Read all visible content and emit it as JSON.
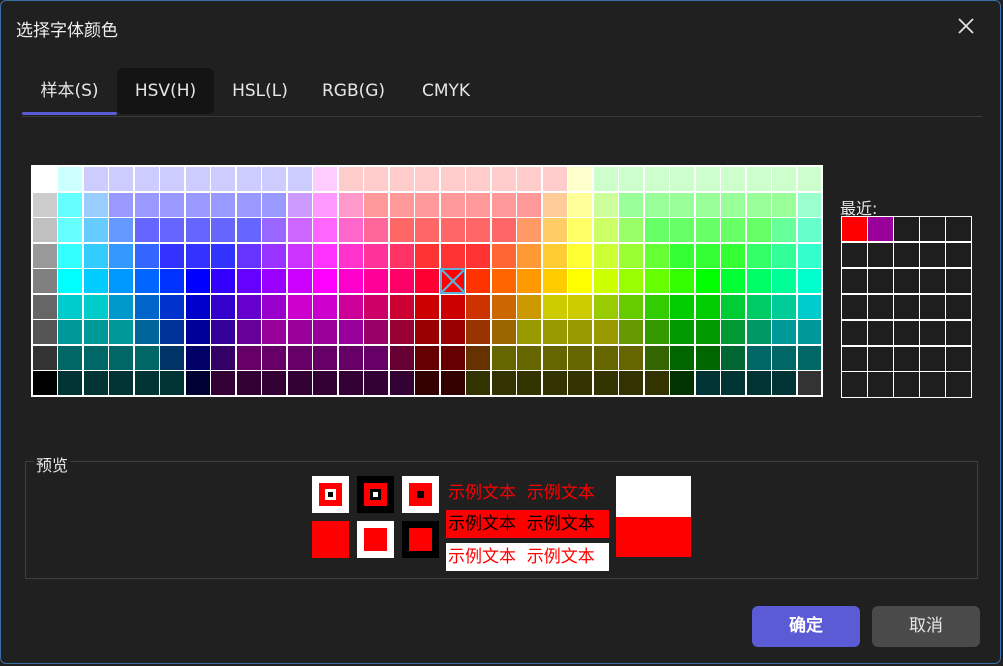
{
  "dialog": {
    "title": "选择字体颜色"
  },
  "tabs": [
    {
      "label": "样本(S)",
      "active": true
    },
    {
      "label": "HSV(H)",
      "hovered": true
    },
    {
      "label": "HSL(L)"
    },
    {
      "label": "RGB(G)"
    },
    {
      "label": "CMYK"
    }
  ],
  "palette": {
    "selected": {
      "row": 4,
      "col": 16
    },
    "rows": [
      [
        "#ffffff",
        "#ccffff",
        "#ccccff",
        "#ccccff",
        "#ccccff",
        "#ccccff",
        "#ccccff",
        "#ccccff",
        "#ccccff",
        "#ccccff",
        "#ccccff",
        "#ffccff",
        "#ffcccc",
        "#ffcccc",
        "#ffcccc",
        "#ffcccc",
        "#ffcccc",
        "#ffcccc",
        "#ffcccc",
        "#ffcccc",
        "#ffcccc",
        "#ffffcc",
        "#ccffcc",
        "#ccffcc",
        "#ccffcc",
        "#ccffcc",
        "#ccffcc",
        "#ccffcc",
        "#ccffcc",
        "#ccffcc",
        "#ccffcc"
      ],
      [
        "#cccccc",
        "#66ffff",
        "#99ccff",
        "#9999ff",
        "#9999ff",
        "#9999ff",
        "#9999ff",
        "#9999ff",
        "#9999ff",
        "#9999ff",
        "#cc99ff",
        "#ff99ff",
        "#ff99cc",
        "#ff9999",
        "#ff9999",
        "#ff9999",
        "#ff9999",
        "#ff9999",
        "#ff9999",
        "#ff9999",
        "#ffcc99",
        "#ffff99",
        "#ccff99",
        "#99ff99",
        "#99ff99",
        "#99ff99",
        "#99ff99",
        "#99ff99",
        "#99ff99",
        "#99ff99",
        "#99ffcc"
      ],
      [
        "#c0c0c0",
        "#66ffff",
        "#66ccff",
        "#6699ff",
        "#6666ff",
        "#6666ff",
        "#6666ff",
        "#6666ff",
        "#6666ff",
        "#9966ff",
        "#cc66ff",
        "#ff66ff",
        "#ff66cc",
        "#ff6699",
        "#ff6666",
        "#ff6666",
        "#ff6666",
        "#ff6666",
        "#ff6666",
        "#ff9966",
        "#ffcc66",
        "#ffff66",
        "#ccff66",
        "#99ff66",
        "#66ff66",
        "#66ff66",
        "#66ff66",
        "#66ff66",
        "#66ff66",
        "#66ff99",
        "#66ffcc"
      ],
      [
        "#999999",
        "#33ffff",
        "#33ccff",
        "#3399ff",
        "#3366ff",
        "#3333ff",
        "#3333ff",
        "#3333ff",
        "#6633ff",
        "#9933ff",
        "#cc33ff",
        "#ff33ff",
        "#ff33cc",
        "#ff3399",
        "#ff3366",
        "#ff3333",
        "#ff3333",
        "#ff3333",
        "#ff6633",
        "#ff9933",
        "#ffcc33",
        "#ffff33",
        "#ccff33",
        "#99ff33",
        "#66ff33",
        "#33ff33",
        "#33ff33",
        "#33ff33",
        "#33ff66",
        "#33ff99",
        "#33ffcc"
      ],
      [
        "#808080",
        "#00ffff",
        "#00ccff",
        "#0099ff",
        "#0066ff",
        "#0033ff",
        "#0000ff",
        "#3300ff",
        "#6600ff",
        "#9900ff",
        "#cc00ff",
        "#ff00ff",
        "#ff00cc",
        "#ff0099",
        "#ff0066",
        "#ff0033",
        "#ff0000",
        "#ff3300",
        "#ff6600",
        "#ff9900",
        "#ffcc00",
        "#ffff00",
        "#ccff00",
        "#99ff00",
        "#66ff00",
        "#33ff00",
        "#00ff00",
        "#00ff33",
        "#00ff66",
        "#00ff99",
        "#00ffcc"
      ],
      [
        "#666666",
        "#00cccc",
        "#00cccc",
        "#0099cc",
        "#0066cc",
        "#0033cc",
        "#0000cc",
        "#3300cc",
        "#6600cc",
        "#9900cc",
        "#cc00cc",
        "#cc00cc",
        "#cc0099",
        "#cc0066",
        "#cc0033",
        "#cc0000",
        "#cc0000",
        "#cc3300",
        "#cc6600",
        "#cc9900",
        "#cccc00",
        "#cccc00",
        "#99cc00",
        "#66cc00",
        "#33cc00",
        "#00cc00",
        "#00cc00",
        "#00cc33",
        "#00cc66",
        "#00cc99",
        "#00cccc"
      ],
      [
        "#555555",
        "#009999",
        "#009999",
        "#009999",
        "#006699",
        "#003399",
        "#000099",
        "#330099",
        "#660099",
        "#990099",
        "#990099",
        "#990099",
        "#990099",
        "#990066",
        "#990033",
        "#990000",
        "#990000",
        "#993300",
        "#996600",
        "#999900",
        "#999900",
        "#999900",
        "#999900",
        "#669900",
        "#339900",
        "#009900",
        "#009900",
        "#009933",
        "#009966",
        "#009999",
        "#009999"
      ],
      [
        "#333333",
        "#006666",
        "#006666",
        "#006666",
        "#006666",
        "#003366",
        "#000066",
        "#330066",
        "#660066",
        "#660066",
        "#660066",
        "#660066",
        "#660066",
        "#660066",
        "#660033",
        "#660000",
        "#660000",
        "#663300",
        "#666600",
        "#666600",
        "#666600",
        "#666600",
        "#666600",
        "#666600",
        "#336600",
        "#006600",
        "#006600",
        "#006633",
        "#006666",
        "#006666",
        "#006666"
      ],
      [
        "#000000",
        "#003333",
        "#003333",
        "#003333",
        "#003333",
        "#003333",
        "#000033",
        "#330033",
        "#330033",
        "#330033",
        "#330033",
        "#330033",
        "#330033",
        "#330033",
        "#330033",
        "#330000",
        "#330000",
        "#333300",
        "#333300",
        "#333300",
        "#333300",
        "#333300",
        "#333300",
        "#333300",
        "#333300",
        "#003300",
        "#003333",
        "#003333",
        "#003333",
        "#003333",
        "#333333"
      ]
    ]
  },
  "recent": {
    "label": "最近:",
    "colors": [
      "#ff0000",
      "#990099",
      "#1e1e1e",
      "#1e1e1e",
      "#1e1e1e",
      "#1e1e1e",
      "#1e1e1e",
      "#1e1e1e",
      "#1e1e1e",
      "#1e1e1e",
      "#1e1e1e",
      "#1e1e1e",
      "#1e1e1e",
      "#1e1e1e",
      "#1e1e1e",
      "#1e1e1e",
      "#1e1e1e",
      "#1e1e1e",
      "#1e1e1e",
      "#1e1e1e",
      "#1e1e1e",
      "#1e1e1e",
      "#1e1e1e",
      "#1e1e1e",
      "#1e1e1e",
      "#1e1e1e",
      "#1e1e1e",
      "#1e1e1e",
      "#1e1e1e",
      "#1e1e1e",
      "#1e1e1e",
      "#1e1e1e",
      "#1e1e1e",
      "#1e1e1e",
      "#1e1e1e"
    ]
  },
  "preview": {
    "label": "预览",
    "sample_text": "示例文本  示例文本",
    "color": "#ff0000"
  },
  "buttons": {
    "ok": "确定",
    "cancel": "取消"
  }
}
